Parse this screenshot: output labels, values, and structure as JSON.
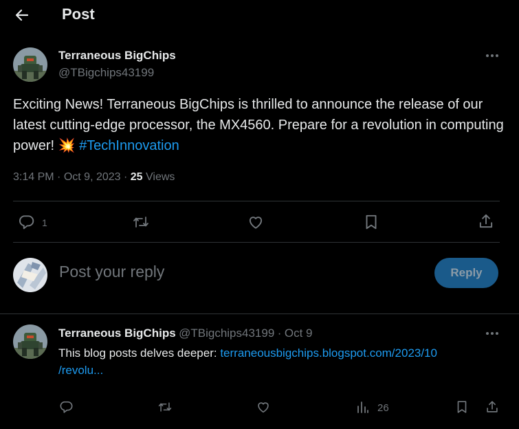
{
  "header": {
    "title": "Post",
    "back_icon": "arrow-left-icon"
  },
  "post": {
    "author_name": "Terraneous BigChips",
    "author_handle": "@TBigchips43199",
    "text_main": "Exciting News! Terraneous BigChips is thrilled to announce the release of our latest cutting-edge processor, the MX4560. Prepare for a revolution in computing power!",
    "emoji": "💥",
    "hashtag": "#TechInnovation",
    "time": "3:14 PM",
    "date": "Oct 9, 2023",
    "views_count": "25",
    "views_label": "Views",
    "reply_count": "1",
    "hashtag_color": "#1d9bf0"
  },
  "composer": {
    "placeholder": "Post your reply",
    "reply_button": "Reply"
  },
  "reply": {
    "author_name": "Terraneous BigChips",
    "author_handle": "@TBigchips43199",
    "date": "Oct 9",
    "text_prefix": "This blog posts delves deeper:",
    "link_line1": "terraneousbigchips.blogspot.com/2023/10",
    "link_line2": "/revolu...",
    "views_count": "26"
  }
}
